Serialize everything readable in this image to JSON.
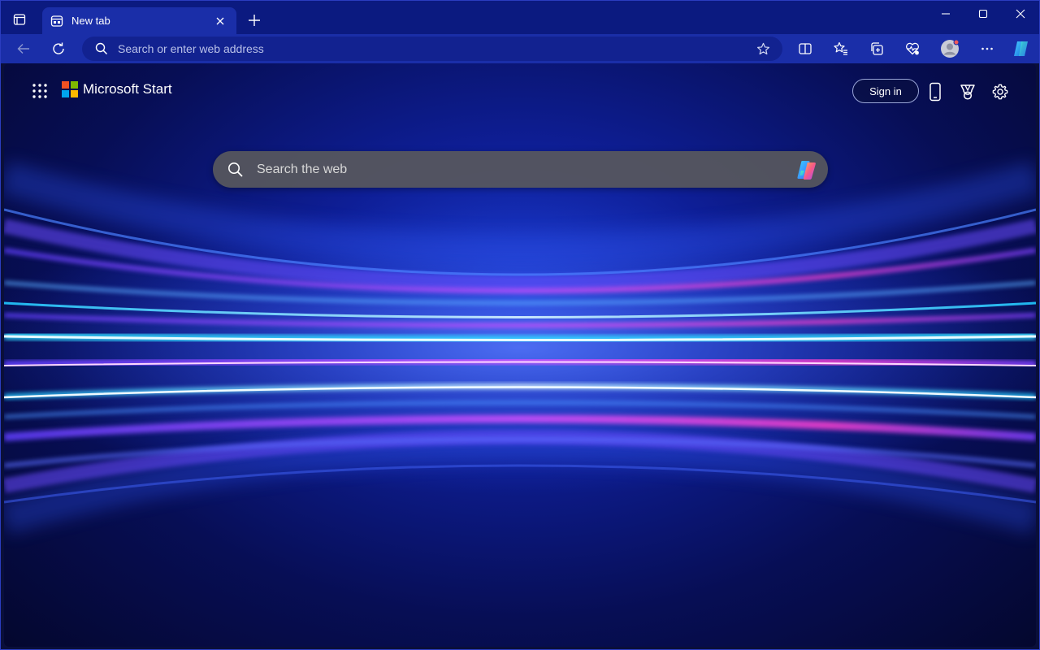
{
  "window": {
    "tab_title": "New tab"
  },
  "toolbar": {
    "address_placeholder": "Search or enter web address"
  },
  "page": {
    "brand": "Microsoft Start",
    "sign_in_label": "Sign in",
    "search_placeholder": "Search the web"
  },
  "colors": {
    "titlebar": "#0b1a80",
    "toolbar": "#1a2ea8",
    "ms_red": "#f25022",
    "ms_green": "#7fba00",
    "ms_blue": "#00a4ef",
    "ms_yellow": "#ffb900"
  },
  "icons": {
    "tab_actions": "tab-actions-icon",
    "tab_favicon": "newtab-page-icon",
    "close": "close-icon",
    "new_tab": "plus-icon",
    "minimize": "minimize-icon",
    "maximize": "maximize-icon",
    "window_close": "window-close-icon",
    "back": "back-arrow-icon",
    "refresh": "refresh-icon",
    "search": "search-icon",
    "favorite": "star-icon",
    "split_screen": "split-screen-icon",
    "favorites": "favorites-icon",
    "collections": "collections-icon",
    "browser_essentials": "heart-pulse-icon",
    "profile": "profile-avatar-icon",
    "more": "ellipsis-icon",
    "copilot": "copilot-icon",
    "app_launcher": "app-launcher-grid-icon",
    "phone": "phone-icon",
    "rewards": "rewards-trophy-icon",
    "settings": "gear-icon"
  }
}
